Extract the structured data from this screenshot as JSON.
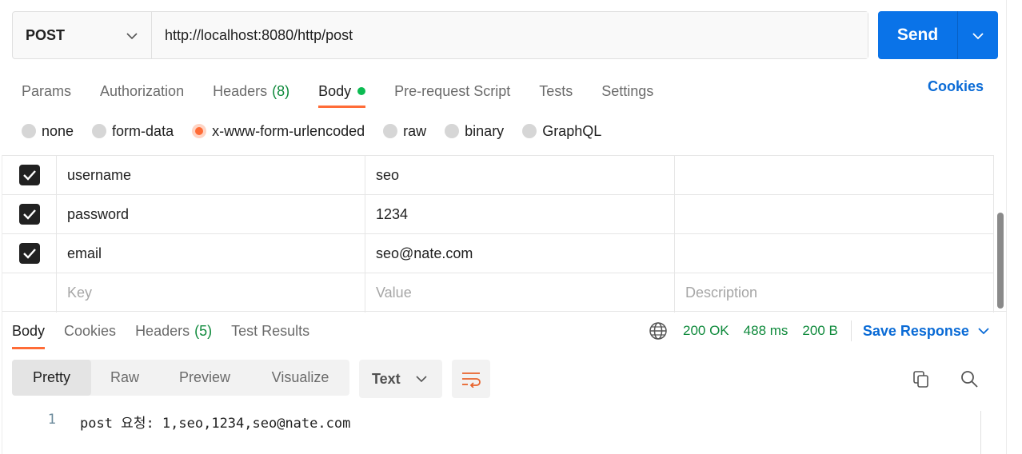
{
  "request": {
    "method": "POST",
    "url": "http://localhost:8080/http/post",
    "send_label": "Send"
  },
  "request_tabs": [
    {
      "label": "Params",
      "count": null,
      "active": false
    },
    {
      "label": "Authorization",
      "count": null,
      "active": false
    },
    {
      "label": "Headers",
      "count": "(8)",
      "active": false
    },
    {
      "label": "Body",
      "count": null,
      "active": true
    },
    {
      "label": "Pre-request Script",
      "count": null,
      "active": false
    },
    {
      "label": "Tests",
      "count": null,
      "active": false
    },
    {
      "label": "Settings",
      "count": null,
      "active": false
    }
  ],
  "cookies_link": "Cookies",
  "body_types": [
    {
      "label": "none",
      "selected": false
    },
    {
      "label": "form-data",
      "selected": false
    },
    {
      "label": "x-www-form-urlencoded",
      "selected": true
    },
    {
      "label": "raw",
      "selected": false
    },
    {
      "label": "binary",
      "selected": false
    },
    {
      "label": "GraphQL",
      "selected": false
    }
  ],
  "form_rows": [
    {
      "checked": true,
      "key": "username",
      "value": "seo",
      "description": ""
    },
    {
      "checked": true,
      "key": "password",
      "value": "1234",
      "description": ""
    },
    {
      "checked": true,
      "key": "email",
      "value": "seo@nate.com",
      "description": ""
    }
  ],
  "form_placeholders": {
    "key": "Key",
    "value": "Value",
    "description": "Description"
  },
  "response_tabs": [
    {
      "label": "Body",
      "count": null,
      "active": true
    },
    {
      "label": "Cookies",
      "count": null,
      "active": false
    },
    {
      "label": "Headers",
      "count": "(5)",
      "active": false
    },
    {
      "label": "Test Results",
      "count": null,
      "active": false
    }
  ],
  "response_meta": {
    "status": "200 OK",
    "time": "488 ms",
    "size": "200 B",
    "save_label": "Save Response"
  },
  "view_modes": [
    {
      "label": "Pretty",
      "active": true
    },
    {
      "label": "Raw",
      "active": false
    },
    {
      "label": "Preview",
      "active": false
    },
    {
      "label": "Visualize",
      "active": false
    }
  ],
  "format_select": "Text",
  "response_body": [
    {
      "line": "1",
      "text": "post 요청: 1,seo,1234,seo@nate.com"
    }
  ],
  "colors": {
    "accent": "#ff6c37",
    "send": "#0a73e8",
    "status_green": "#0f8a3c",
    "link_blue": "#0a6bd6"
  },
  "icons": [
    "chevron-down-icon",
    "globe-icon",
    "wrap-lines-icon",
    "copy-icon",
    "search-icon",
    "checkmark-icon"
  ]
}
